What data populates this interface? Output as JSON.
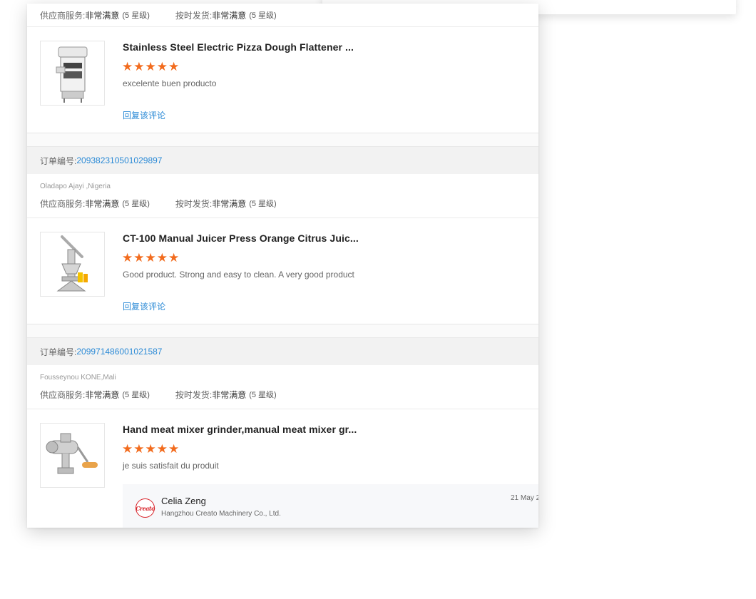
{
  "top_ratings": {
    "service_label": "供应商服务:",
    "service_value": "非常满意",
    "service_level": "(5 星级)",
    "delivery_label": "按时发货:",
    "delivery_value": "非常满意",
    "delivery_level": "(5 星级)"
  },
  "reviews": [
    {
      "product_title": "Stainless Steel Electric Pizza Dough Flattener ...",
      "stars": "★★★★★",
      "text": "excelente buen producto",
      "reply_link": "回复该评论"
    },
    {
      "order_label": "订单编号:",
      "order_number": "209382310501029897",
      "buyer": "Oladapo Ajayi ,Nigeria",
      "service_label": "供应商服务:",
      "service_value": "非常满意",
      "service_level": "(5 星级)",
      "delivery_label": "按时发货:",
      "delivery_value": "非常满意",
      "delivery_level": "(5 星级)",
      "product_title": "CT-100 Manual Juicer Press Orange Citrus Juic...",
      "stars": "★★★★★",
      "text": "Good product. Strong and easy to clean. A very good product",
      "reply_link": "回复该评论"
    },
    {
      "order_label": "订单编号:",
      "order_number": "209971486001021587",
      "buyer": "Fousseynou KONE,Mali",
      "service_label": "供应商服务:",
      "service_value": "非常满意",
      "service_level": "(5 星级)",
      "delivery_label": "按时发货:",
      "delivery_value": "非常满意",
      "delivery_level": "(5 星级)",
      "product_title": "Hand meat mixer grinder,manual meat mixer gr...",
      "stars": "★★★★★",
      "text": "je suis satisfait du produit",
      "supplier_reply": {
        "logo_text": "Creato",
        "name": "Celia Zeng",
        "company": "Hangzhou Creato Machinery Co., Ltd.",
        "date": "21 May 2"
      }
    }
  ],
  "colors": {
    "star": "#f26b1d",
    "link": "#2b8ad6",
    "logo": "#d8232a"
  }
}
